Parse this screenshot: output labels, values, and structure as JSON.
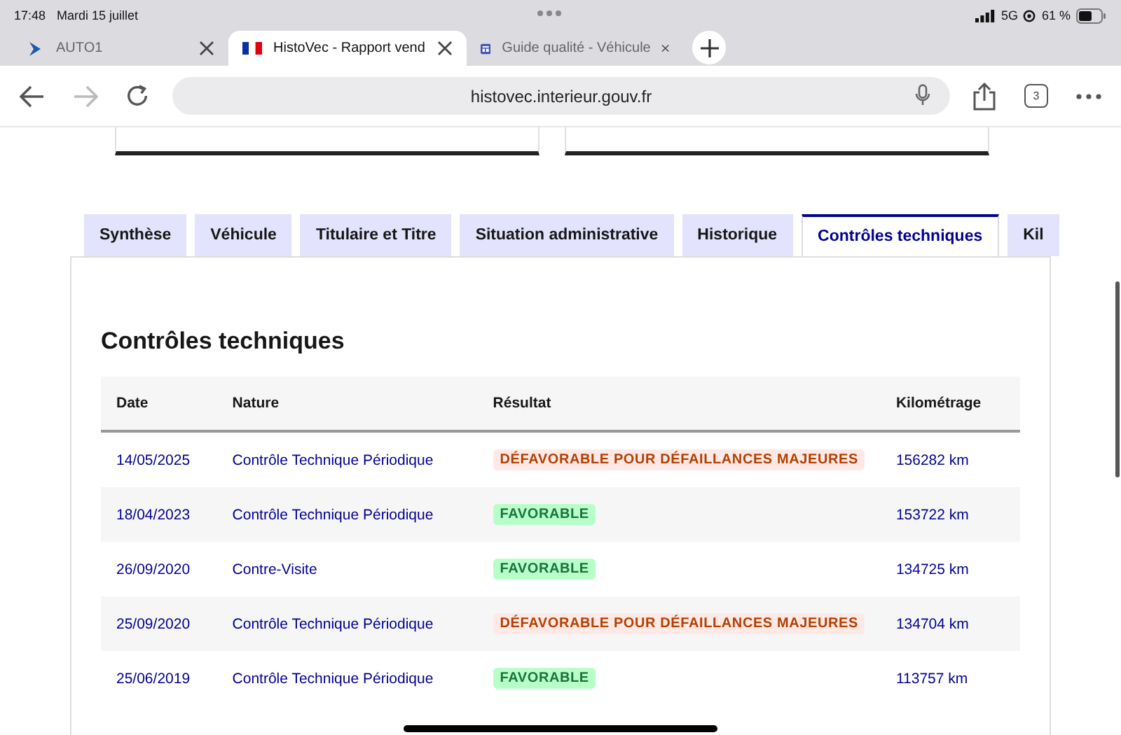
{
  "status_bar": {
    "time": "17:48",
    "date": "Mardi 15 juillet",
    "network": "5G",
    "battery": "61 %"
  },
  "browser_tabs": [
    {
      "title": "AUTO1",
      "selected": false
    },
    {
      "title": "HistoVec - Rapport vend",
      "selected": true
    },
    {
      "title": "Guide qualité - Véhicule",
      "selected": false
    }
  ],
  "address_bar": {
    "url": "histovec.interieur.gouv.fr",
    "tab_count": "3"
  },
  "page_tabs": [
    {
      "label": "Synthèse",
      "selected": false
    },
    {
      "label": "Véhicule",
      "selected": false
    },
    {
      "label": "Titulaire et Titre",
      "selected": false
    },
    {
      "label": "Situation administrative",
      "selected": false
    },
    {
      "label": "Historique",
      "selected": false
    },
    {
      "label": "Contrôles techniques",
      "selected": true
    },
    {
      "label": "Kil",
      "selected": false
    }
  ],
  "section": {
    "title": "Contrôles techniques",
    "table": {
      "columns": [
        "Date",
        "Nature",
        "Résultat",
        "Kilométrage"
      ],
      "rows": [
        {
          "date": "14/05/2025",
          "nature": "Contrôle Technique Périodique",
          "result": "DÉFAVORABLE POUR DÉFAILLANCES MAJEURES",
          "kind": "unfavorable",
          "mileage": "156282 km"
        },
        {
          "date": "18/04/2023",
          "nature": "Contrôle Technique Périodique",
          "result": "FAVORABLE",
          "kind": "favorable",
          "mileage": "153722 km"
        },
        {
          "date": "26/09/2020",
          "nature": "Contre-Visite",
          "result": "FAVORABLE",
          "kind": "favorable",
          "mileage": "134725 km"
        },
        {
          "date": "25/09/2020",
          "nature": "Contrôle Technique Périodique",
          "result": "DÉFAVORABLE POUR DÉFAILLANCES MAJEURES",
          "kind": "unfavorable",
          "mileage": "134704 km"
        },
        {
          "date": "25/06/2019",
          "nature": "Contrôle Technique Périodique",
          "result": "FAVORABLE",
          "kind": "favorable",
          "mileage": "113757 km"
        }
      ]
    }
  }
}
